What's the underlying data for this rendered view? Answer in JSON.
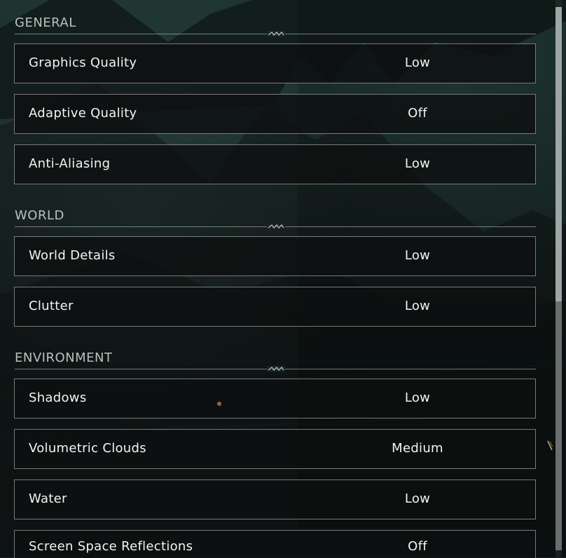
{
  "sections": [
    {
      "title": "GENERAL",
      "settings": [
        {
          "label": "Graphics Quality",
          "value": "Low"
        },
        {
          "label": "Adaptive Quality",
          "value": "Off"
        },
        {
          "label": "Anti-Aliasing",
          "value": "Low"
        }
      ]
    },
    {
      "title": "WORLD",
      "settings": [
        {
          "label": "World Details",
          "value": "Low"
        },
        {
          "label": "Clutter",
          "value": "Low"
        }
      ]
    },
    {
      "title": "ENVIRONMENT",
      "settings": [
        {
          "label": "Shadows",
          "value": "Low"
        },
        {
          "label": "Volumetric Clouds",
          "value": "Medium"
        },
        {
          "label": "Water",
          "value": "Low"
        },
        {
          "label": "Screen Space Reflections",
          "value": "Off"
        }
      ]
    }
  ],
  "icons": {
    "section_ornament": "ornament-icon"
  },
  "colors": {
    "header_text": "#b9c0be",
    "row_text": "#f2f4f3",
    "row_border": "#afb6b4"
  }
}
